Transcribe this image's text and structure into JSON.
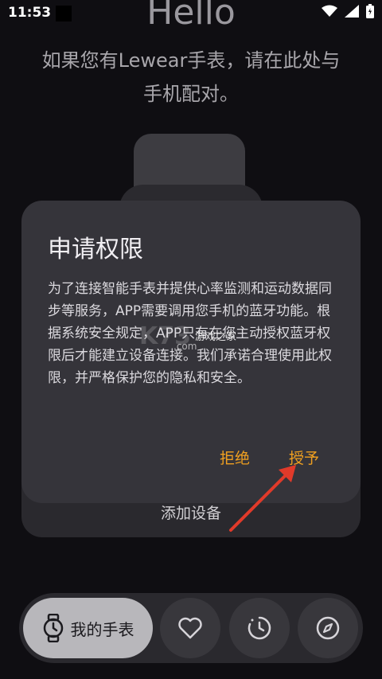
{
  "status_bar": {
    "time": "11:53"
  },
  "header": {
    "hello": "Hello",
    "subtitle_line1": "如果您有Lewear手表，请在此处与",
    "subtitle_line2": "手机配对。"
  },
  "add_device": {
    "label": "添加设备"
  },
  "dialog": {
    "title": "申请权限",
    "body": "为了连接智能手表并提供心率监测和运动数据同步等服务，APP需要调用您手机的蓝牙功能。根据系统安全规定，APP只有在您主动授权蓝牙权限后才能建立设备连接。我们承诺合理使用此权限，并严格保护您的隐私和安全。",
    "deny_label": "拒绝",
    "grant_label": "授予",
    "accent": "#f0a020"
  },
  "watermark": {
    "logo": "K73",
    "sub": "游戏之家",
    "domain": ".com"
  },
  "bottom_nav": {
    "my_watch_label": "我的手表",
    "icons": [
      "watch-icon",
      "heart-icon",
      "clock-icon",
      "compass-icon"
    ]
  },
  "colors": {
    "background": "#0f0e12",
    "dialog": "#35343a",
    "arrow": "#e03a2a"
  }
}
